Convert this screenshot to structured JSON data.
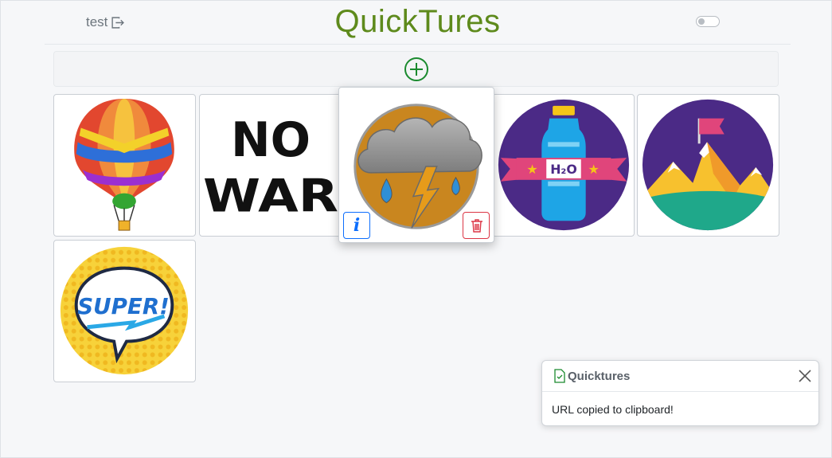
{
  "header": {
    "username": "test",
    "title": "QuickTures",
    "toggle_on": false
  },
  "gallery": {
    "images": [
      {
        "name": "hot-air-balloon",
        "text": ""
      },
      {
        "name": "no-war",
        "text": "NO WAR"
      },
      {
        "name": "storm-cloud",
        "text": ""
      },
      {
        "name": "water-bottle",
        "text": "H2O"
      },
      {
        "name": "mountain-flag",
        "text": ""
      },
      {
        "name": "super-speech-bubble",
        "text": "SUPER!"
      }
    ],
    "selected_actions": {
      "info_label": "i"
    }
  },
  "toast": {
    "title": "Quicktures",
    "message": "URL copied to clipboard!"
  },
  "colors": {
    "title": "#5e8a1c",
    "add_button": "#1a8a2e",
    "info_button": "#0d6efd",
    "delete_button": "#dc3545"
  }
}
